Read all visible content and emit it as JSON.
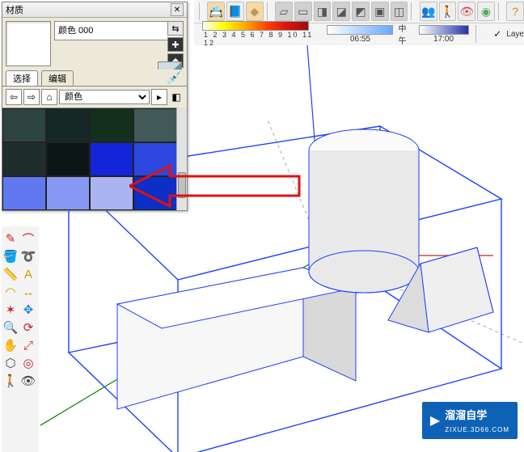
{
  "toolbar_top": {
    "icons": [
      "print",
      "book",
      "diamond",
      "legend",
      "cube1",
      "cube2",
      "cube3",
      "cube4",
      "iso",
      "plane",
      "shape",
      "people",
      "walk",
      "eye",
      "look",
      "help"
    ]
  },
  "time_bar": {
    "scale_numbers": "1 2 3 4 5 6 7 8 9 10 11 12",
    "time1": "06:55",
    "label_mid": "中午",
    "time2": "17:00",
    "layer_check": "✓",
    "layer_label": "Laye"
  },
  "panel": {
    "title": "材质",
    "mat_name": "颜色 000",
    "tabs": {
      "select": "选择",
      "edit": "编辑"
    },
    "category": "颜色",
    "swatches": [
      "#2d4441",
      "#152825",
      "#13301c",
      "#415a57",
      "#1f2e2d",
      "#0b1716",
      "#1424d8",
      "#2e48df",
      "#6278f1",
      "#8798f4",
      "#aab4f2",
      "#0b2fc7"
    ]
  },
  "watermark": {
    "text": "溜溜自学",
    "sub": "ZIXUE.3D66.COM"
  }
}
